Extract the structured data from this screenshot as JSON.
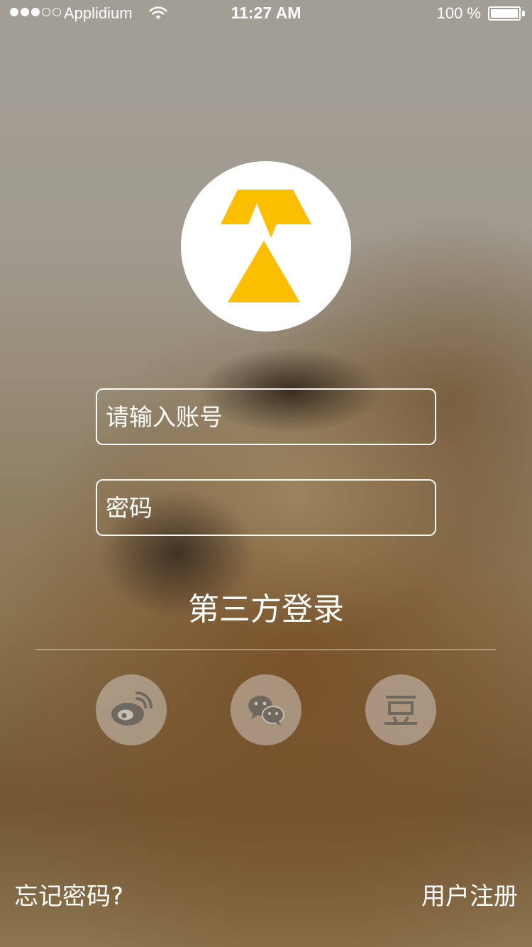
{
  "status_bar": {
    "carrier": "Applidium",
    "time": "11:27 AM",
    "battery_percent": "100 %",
    "signal_bars_filled": 3,
    "signal_bars_total": 5,
    "wifi_icon": "wifi-icon",
    "battery_level": 1.0
  },
  "logo": {
    "icon": "logo-triangles-icon",
    "color": "#FCBE00",
    "background": "#FFFFFF"
  },
  "form": {
    "account_placeholder": "请输入账号",
    "account_value": "",
    "password_placeholder": "密码",
    "password_value": ""
  },
  "third_party": {
    "title": "第三方登录",
    "buttons": [
      {
        "icon": "weibo-icon"
      },
      {
        "icon": "wechat-icon"
      },
      {
        "icon": "douban-icon"
      }
    ]
  },
  "footer": {
    "forgot_password": "忘记密码?",
    "register": "用户注册"
  },
  "colors": {
    "accent": "#FCBE00",
    "text": "#FFFFFF",
    "social_icon": "#6F6860"
  }
}
